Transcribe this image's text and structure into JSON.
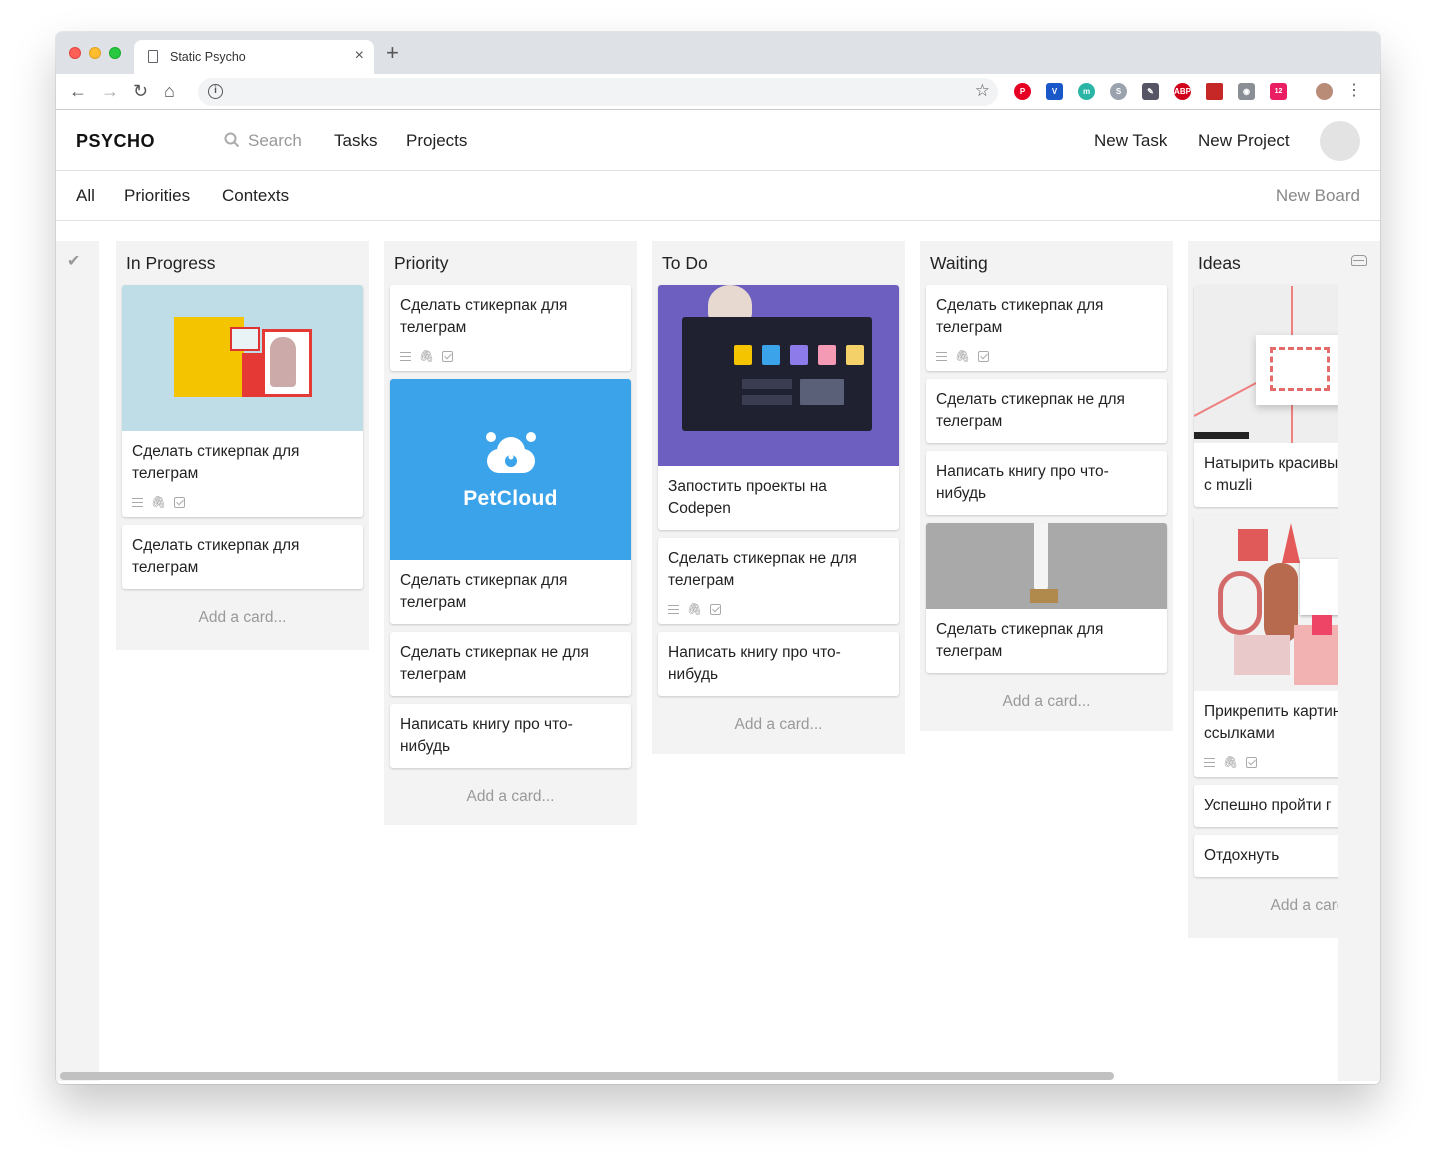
{
  "browser": {
    "tab_title": "Static Psycho",
    "close_symbol": "×",
    "new_tab_symbol": "+",
    "extension_badge": "12",
    "abp_label": "ABP"
  },
  "app": {
    "logo": "PSYCHO",
    "search_placeholder": "Search",
    "nav": {
      "tasks": "Tasks",
      "projects": "Projects",
      "new_task": "New Task",
      "new_project": "New Project"
    },
    "subnav": {
      "all": "All",
      "priorities": "Priorities",
      "contexts": "Contexts",
      "new_board": "New Board"
    }
  },
  "lists": [
    {
      "title": "In Progress",
      "cards": [
        {
          "text": "Сделать стикерпак для телеграм"
        },
        {
          "text": "Сделать стикерпак для телеграм"
        }
      ],
      "add": "Add a card..."
    },
    {
      "title": "Priority",
      "cards": [
        {
          "text": "Сделать стикерпак для телеграм"
        },
        {
          "text": "Сделать стикерпак для телеграм",
          "image_text": "PetCloud"
        },
        {
          "text": "Сделать стикерпак не для телеграм"
        },
        {
          "text": "Написать книгу про что-нибудь"
        }
      ],
      "add": "Add a card..."
    },
    {
      "title": "To Do",
      "cards": [
        {
          "text": "Запостить проекты на Codepen"
        },
        {
          "text": "Сделать стикерпак не для телеграм"
        },
        {
          "text": "Написать книгу про что-нибудь"
        }
      ],
      "add": "Add a card..."
    },
    {
      "title": "Waiting",
      "cards": [
        {
          "text": "Сделать стикерпак для телеграм"
        },
        {
          "text": "Сделать стикерпак не для телеграм"
        },
        {
          "text": "Написать книгу про что-нибудь"
        },
        {
          "text": "Сделать стикерпак для телеграм"
        }
      ],
      "add": "Add a card..."
    },
    {
      "title": "Ideas",
      "cards": [
        {
          "text": "Натырить красивых картинок с muzli"
        },
        {
          "text": "Прикрепить картинки ссылками"
        },
        {
          "text": "Успешно пройти г"
        },
        {
          "text": "Отдохнуть"
        }
      ],
      "add": "Add a card..."
    }
  ],
  "colors": {
    "list_bg": "#f3f3f3",
    "petcloud_blue": "#3aa3ea",
    "dashboard_purple": "#6d5fc0"
  },
  "icons": [
    "search-icon",
    "check-icon",
    "inbox-icon",
    "description-icon",
    "attachment-icon",
    "checklist-icon"
  ]
}
